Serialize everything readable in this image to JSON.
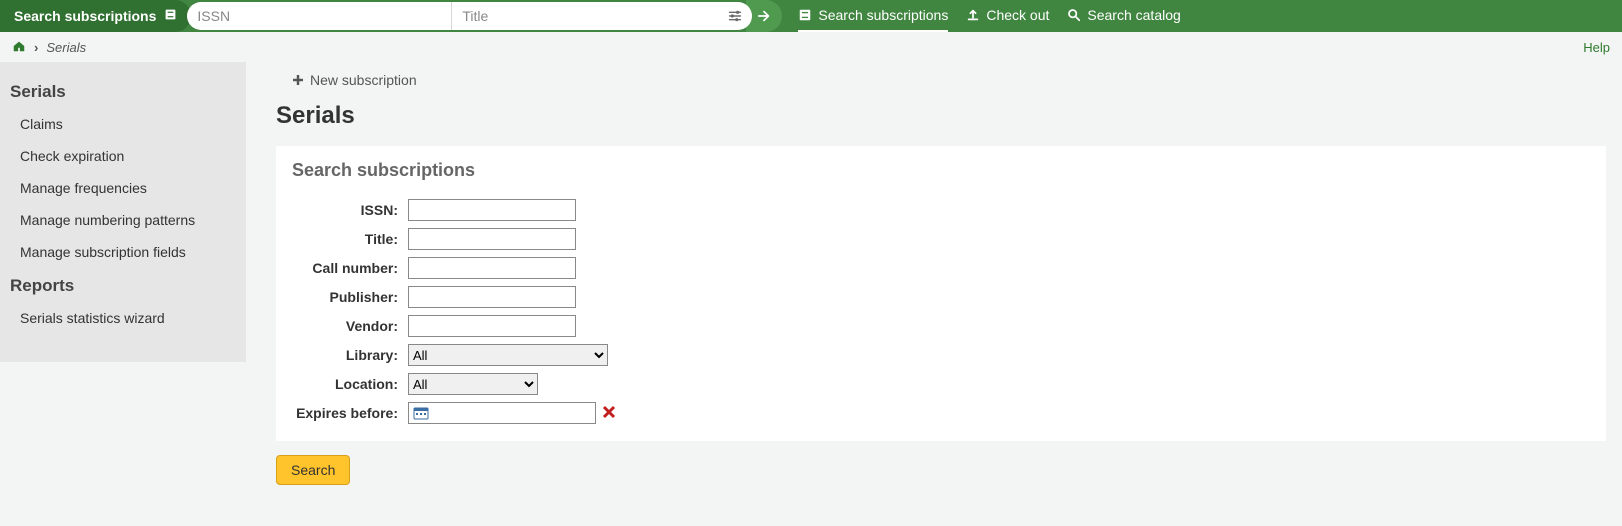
{
  "topbar": {
    "scope_label": "Search subscriptions",
    "issn_placeholder": "ISSN",
    "title_placeholder": "Title",
    "nav": {
      "search_subscriptions": "Search subscriptions",
      "check_out": "Check out",
      "search_catalog": "Search catalog"
    }
  },
  "breadcrumb": {
    "current": "Serials",
    "help": "Help"
  },
  "sidebar": {
    "section1_heading": "Serials",
    "section1_items": [
      "Claims",
      "Check expiration",
      "Manage frequencies",
      "Manage numbering patterns",
      "Manage subscription fields"
    ],
    "section2_heading": "Reports",
    "section2_items": [
      "Serials statistics wizard"
    ]
  },
  "content": {
    "new_subscription": "New subscription",
    "page_title": "Serials",
    "panel_heading": "Search subscriptions",
    "form": {
      "issn_label": "ISSN:",
      "title_label": "Title:",
      "callnumber_label": "Call number:",
      "publisher_label": "Publisher:",
      "vendor_label": "Vendor:",
      "library_label": "Library:",
      "library_selected": "All",
      "location_label": "Location:",
      "location_selected": "All",
      "expires_label": "Expires before:",
      "search_button": "Search"
    }
  }
}
